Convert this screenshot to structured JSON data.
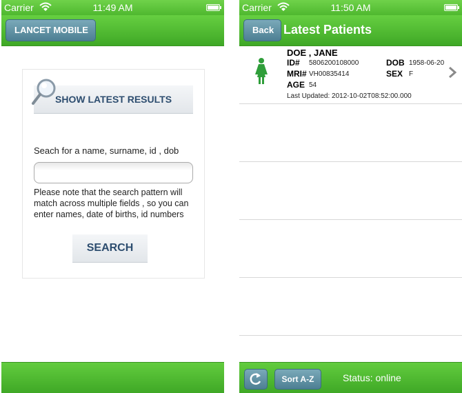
{
  "left": {
    "status": {
      "carrier": "Carrier",
      "time": "11:49 AM"
    },
    "nav": {
      "back_label": "LANCET MOBILE"
    },
    "search": {
      "latest_label": "SHOW LATEST RESULTS",
      "prompt": "Seach for a name, surname, id , dob",
      "input_value": "",
      "note": "Please note that the search pattern will match across multiple fields , so you can enter names, date of births, id numbers",
      "button_label": "SEARCH"
    }
  },
  "right": {
    "status": {
      "carrier": "Carrier",
      "time": "11:50 AM"
    },
    "nav": {
      "back_label": "Back",
      "title": "Latest Patients"
    },
    "patients": [
      {
        "name": "DOE , JANE",
        "id_label": "ID#",
        "id": "5806200108000",
        "dob_label": "DOB",
        "dob": "1958-06-20",
        "mri_label": "MRI#",
        "mri": "VH00835414",
        "sex_label": "SEX",
        "sex": "F",
        "age_label": "AGE",
        "age": "54",
        "last_updated": "Last Updated: 2012-10-02T08:52:00.000"
      }
    ],
    "toolbar": {
      "sort_label": "Sort A-Z",
      "status_text": "Status: online"
    }
  },
  "colors": {
    "bar_green": "#4fb82f",
    "button_blue": "#5d8ea2",
    "label_navy": "#2d4d6f",
    "female_icon": "#2f9e3a"
  }
}
